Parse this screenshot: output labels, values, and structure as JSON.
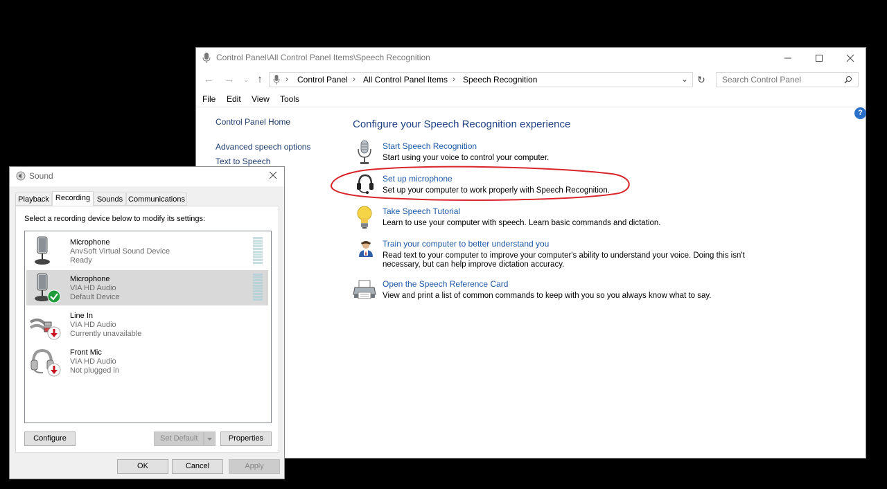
{
  "control_panel": {
    "title": "Control Panel\\All Control Panel Items\\Speech Recognition",
    "breadcrumb": [
      "Control Panel",
      "All Control Panel Items",
      "Speech Recognition"
    ],
    "search_placeholder": "Search Control Panel",
    "menu": [
      "File",
      "Edit",
      "View",
      "Tools"
    ],
    "sidebar": [
      "Control Panel Home",
      "Advanced speech options",
      "Text to Speech"
    ],
    "heading": "Configure your Speech Recognition experience",
    "tasks": [
      {
        "title": "Start Speech Recognition",
        "desc": "Start using your voice to control your computer.",
        "icon": "microphone-icon"
      },
      {
        "title": "Set up microphone",
        "desc": "Set up your computer to work properly with Speech Recognition.",
        "icon": "headset-icon"
      },
      {
        "title": "Take Speech Tutorial",
        "desc": "Learn to use your computer with speech.  Learn basic commands and dictation.",
        "icon": "lightbulb-icon"
      },
      {
        "title": "Train your computer to better understand you",
        "desc": "Read text to your computer to improve your computer's ability to understand your voice.  Doing this isn't necessary, but can help improve dictation accuracy.",
        "icon": "user-icon"
      },
      {
        "title": "Open the Speech Reference Card",
        "desc": "View and print a list of common commands to keep with you so you always know what to say.",
        "icon": "printer-icon"
      }
    ],
    "annotation_color": "#d9262b"
  },
  "sound": {
    "title": "Sound",
    "tabs": [
      "Playback",
      "Recording",
      "Sounds",
      "Communications"
    ],
    "active_tab": "Recording",
    "instruction": "Select a recording device below to modify its settings:",
    "devices": [
      {
        "name": "Microphone",
        "driver": "AnvSoft Virtual Sound Device",
        "status": "Ready",
        "icon": "microphone-device-icon"
      },
      {
        "name": "Microphone",
        "driver": "VIA HD Audio",
        "status": "Default Device",
        "icon": "microphone-device-icon",
        "badge": "default-check-icon"
      },
      {
        "name": "Line In",
        "driver": "VIA HD Audio",
        "status": "Currently unavailable",
        "icon": "line-in-cable-icon",
        "badge": "unavailable-arrow-icon"
      },
      {
        "name": "Front Mic",
        "driver": "VIA HD Audio",
        "status": "Not plugged in",
        "icon": "headset-device-icon",
        "badge": "unavailable-arrow-icon"
      }
    ],
    "buttons": {
      "configure": "Configure",
      "set_default": "Set Default",
      "properties": "Properties",
      "ok": "OK",
      "cancel": "Cancel",
      "apply": "Apply"
    }
  }
}
